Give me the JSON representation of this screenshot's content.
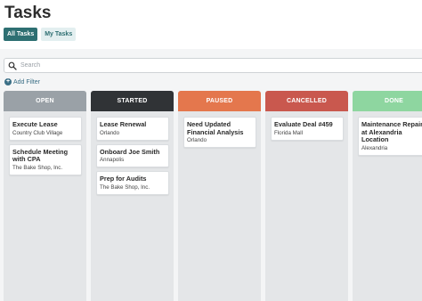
{
  "header": {
    "title": "Tasks"
  },
  "tabs": [
    {
      "label": "All Tasks",
      "active": true
    },
    {
      "label": "My Tasks",
      "active": false
    }
  ],
  "search": {
    "placeholder": "Search",
    "icon": "search-icon"
  },
  "filters": {
    "add_label": "Add Filter",
    "icon": "plus-circle-icon"
  },
  "colors": {
    "accent": "#2e6f72",
    "open": "#9aa1a7",
    "started": "#303336",
    "paused": "#e4774d",
    "cancelled": "#c9584e",
    "done": "#8ed6a0"
  },
  "columns": [
    {
      "name": "OPEN",
      "cards": [
        {
          "title": "Execute Lease",
          "subtitle": "Country Club Village"
        },
        {
          "title": "Schedule Meeting with CPA",
          "subtitle": "The Bake Shop, Inc."
        }
      ]
    },
    {
      "name": "STARTED",
      "cards": [
        {
          "title": "Lease Renewal",
          "subtitle": "Orlando"
        },
        {
          "title": "Onboard Joe Smith",
          "subtitle": "Annapolis"
        },
        {
          "title": "Prep for Audits",
          "subtitle": "The Bake Shop, Inc."
        }
      ]
    },
    {
      "name": "PAUSED",
      "cards": [
        {
          "title": "Need Updated Financial Analysis",
          "subtitle": "Orlando"
        }
      ]
    },
    {
      "name": "CANCELLED",
      "cards": [
        {
          "title": "Evaluate Deal #459",
          "subtitle": "Florida Mall"
        }
      ]
    },
    {
      "name": "DONE",
      "cards": [
        {
          "title": "Maintenance Repair at Alexandria Location",
          "subtitle": "Alexandria"
        }
      ]
    }
  ]
}
